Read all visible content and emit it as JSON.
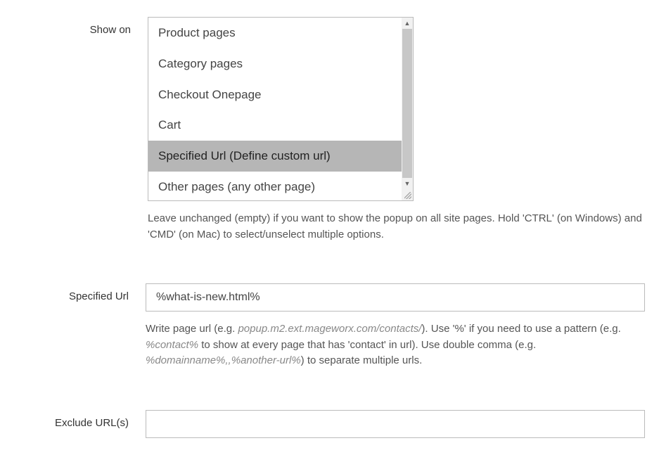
{
  "show_on": {
    "label": "Show on",
    "options": [
      {
        "label": "Product pages",
        "selected": false
      },
      {
        "label": "Category pages",
        "selected": false
      },
      {
        "label": "Checkout Onepage",
        "selected": false
      },
      {
        "label": "Cart",
        "selected": false
      },
      {
        "label": "Specified Url (Define custom url)",
        "selected": true
      },
      {
        "label": "Other pages (any other page)",
        "selected": false
      }
    ],
    "help": "Leave unchanged (empty) if you want to show the popup on all site pages. Hold 'CTRL' (on Windows) and 'CMD' (on Mac) to select/unselect multiple options."
  },
  "specified_url": {
    "label": "Specified Url",
    "value": "%what-is-new.html%",
    "help_pre": "Write page url (e.g. ",
    "help_ex1": "popup.m2.ext.mageworx.com/contacts/",
    "help_mid1": "). Use '%' if you need to use a pattern (e.g. ",
    "help_ex2": "%contact%",
    "help_mid2": " to show at every page that has 'contact' in url). Use double comma (e.g. ",
    "help_ex3": "%domainname%,,%another-url%",
    "help_post": ") to separate multiple urls."
  },
  "exclude_urls": {
    "label": "Exclude URL(s)",
    "value": ""
  }
}
